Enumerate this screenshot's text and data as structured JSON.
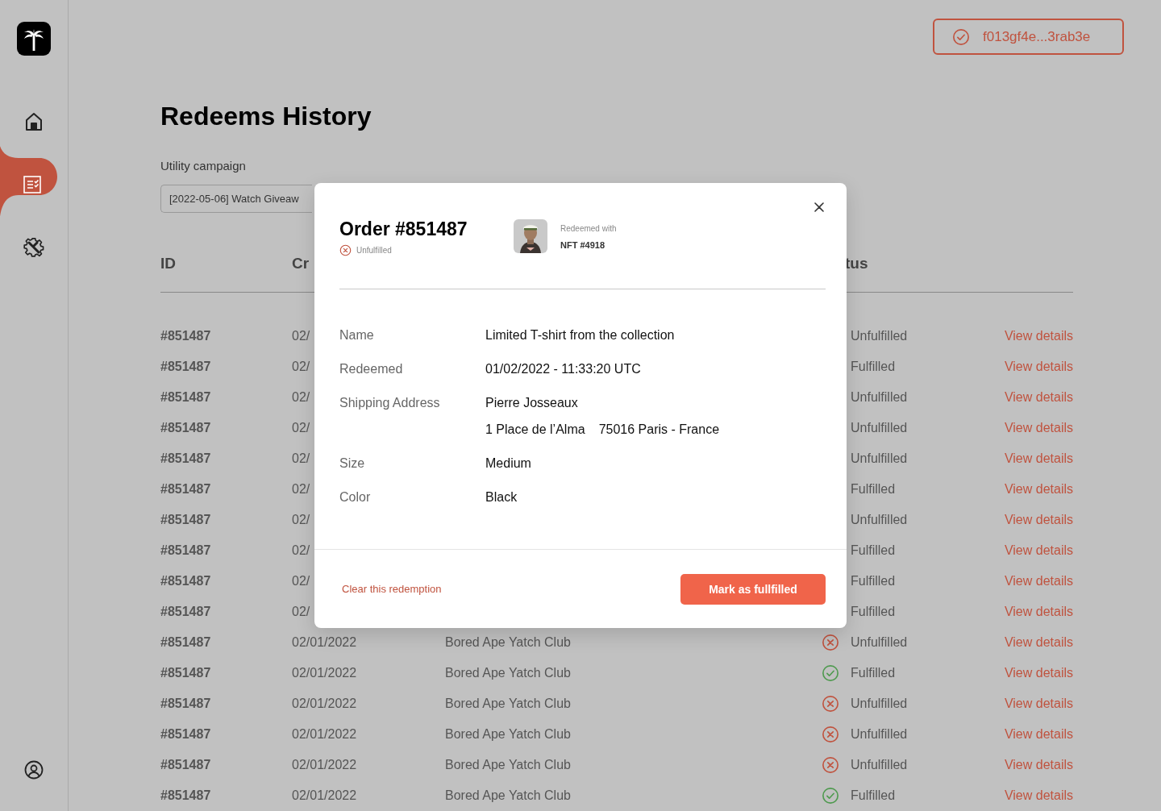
{
  "wallet": {
    "address": "f013gf4e...3rab3e"
  },
  "sidebar": {
    "items": [
      {
        "kind": "home",
        "selected": false
      },
      {
        "kind": "redeems",
        "selected": true
      },
      {
        "kind": "settings",
        "selected": false
      }
    ],
    "footer": {
      "kind": "profile"
    }
  },
  "page": {
    "title": "Redeems History",
    "campaign_label": "Utility campaign",
    "campaign_value": "[2022-05-06] Watch Giveaw"
  },
  "table": {
    "columns": [
      "ID",
      "Cr",
      "",
      "tus"
    ],
    "rows": [
      {
        "id": "#851487",
        "date": "02/",
        "status": "Unfulfilled",
        "action": "View details"
      },
      {
        "id": "#851487",
        "date": "02/",
        "status": "Fulfilled",
        "action": "View details"
      },
      {
        "id": "#851487",
        "date": "02/",
        "status": "Unfulfilled",
        "action": "View details"
      },
      {
        "id": "#851487",
        "date": "02/",
        "status": "Unfulfilled",
        "action": "View details"
      },
      {
        "id": "#851487",
        "date": "02/",
        "status": "Unfulfilled",
        "action": "View details"
      },
      {
        "id": "#851487",
        "date": "02/",
        "status": "Fulfilled",
        "action": "View details"
      },
      {
        "id": "#851487",
        "date": "02/",
        "status": "Unfulfilled",
        "action": "View details"
      },
      {
        "id": "#851487",
        "date": "02/",
        "status": "Fulfilled",
        "action": "View details"
      },
      {
        "id": "#851487",
        "date": "02/",
        "status": "Fulfilled",
        "action": "View details"
      },
      {
        "id": "#851487",
        "date": "02/",
        "status": "Fulfilled",
        "action": "View details"
      },
      {
        "id": "#851487",
        "date": "02/01/2022",
        "collection": "Bored Ape Yatch Club",
        "fulfilled": false,
        "status": "Unfulfilled",
        "action": "View details"
      },
      {
        "id": "#851487",
        "date": "02/01/2022",
        "collection": "Bored Ape Yatch Club",
        "fulfilled": true,
        "status": "Fulfilled",
        "action": "View details"
      },
      {
        "id": "#851487",
        "date": "02/01/2022",
        "collection": "Bored Ape Yatch Club",
        "fulfilled": false,
        "status": "Unfulfilled",
        "action": "View details"
      },
      {
        "id": "#851487",
        "date": "02/01/2022",
        "collection": "Bored Ape Yatch Club",
        "fulfilled": false,
        "status": "Unfulfilled",
        "action": "View details"
      },
      {
        "id": "#851487",
        "date": "02/01/2022",
        "collection": "Bored Ape Yatch Club",
        "fulfilled": false,
        "status": "Unfulfilled",
        "action": "View details"
      },
      {
        "id": "#851487",
        "date": "02/01/2022",
        "collection": "Bored Ape Yatch Club",
        "fulfilled": true,
        "status": "Fulfilled",
        "action": "View details"
      }
    ]
  },
  "modal": {
    "title": "Order #851487",
    "fulfilled": false,
    "status": "Unfulfilled",
    "nft": {
      "kind": "picture",
      "caption": "Redeemed with",
      "name": "NFT #4918"
    },
    "details": [
      {
        "label": "Name",
        "lines": [
          "Limited T-shirt from the collection"
        ]
      },
      {
        "label": "Redeemed",
        "lines": [
          "01/02/2022 - 11:33:20 UTC"
        ]
      },
      {
        "label": "Shipping Address",
        "lines": [
          "Pierre Josseaux",
          "1 Place de l’Alma",
          "75016 Paris - France"
        ]
      },
      {
        "label": "Size",
        "lines": [
          "Medium"
        ]
      },
      {
        "label": "Color",
        "lines": [
          "Black"
        ]
      }
    ],
    "secondary_action": "Clear this redemption",
    "primary_action": "Mark as fullfilled"
  }
}
